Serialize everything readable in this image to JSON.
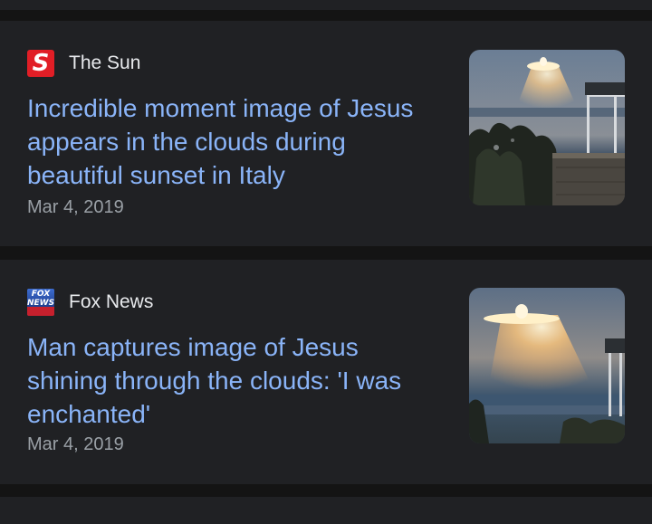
{
  "articles": [
    {
      "source": "The Sun",
      "logo_letter": "S",
      "headline": "Incredible moment image of Jesus appears in the clouds during beautiful sunset in Italy",
      "date": "Mar 4, 2019"
    },
    {
      "source": "Fox News",
      "logo_text": "FOX NEWS",
      "headline": "Man captures image of Jesus shining through the clouds: 'I was enchanted'",
      "date": "Mar 4, 2019"
    }
  ],
  "colors": {
    "background": "#141414",
    "card": "#202124",
    "headline": "#8ab4f8",
    "source": "#e8eaed",
    "date": "#9aa0a6",
    "sun_red": "#e11e26",
    "fox_blue": "#1e3f8f"
  }
}
